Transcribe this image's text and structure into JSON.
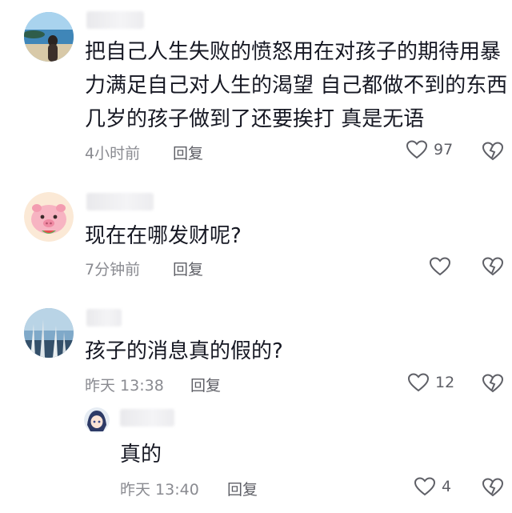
{
  "comments": [
    {
      "text": "把自己人生失败的愤怒用在对孩子的期待用暴\n力满足自己对人生的渴望 自己都做不到的东西\n几岁的孩子做到了还要挨打 真是无语",
      "time": "4小时前",
      "reply": "回复",
      "likes": "97",
      "avatar_icon": "beach-photo-avatar"
    },
    {
      "text": "现在在哪发财呢?",
      "time": "7分钟前",
      "reply": "回复",
      "likes": "",
      "avatar_icon": "pig-avatar"
    },
    {
      "text": "孩子的消息真的假的?",
      "time": "昨天 13:38",
      "reply": "回复",
      "likes": "12",
      "avatar_icon": "reed-photo-avatar"
    }
  ],
  "reply_item": {
    "text": "真的",
    "time": "昨天 13:40",
    "reply": "回复",
    "likes": "4",
    "avatar_icon": "anime-avatar"
  },
  "colors": {
    "text": "#161823",
    "meta": "#8a8b91",
    "icon": "#5e5f66"
  }
}
